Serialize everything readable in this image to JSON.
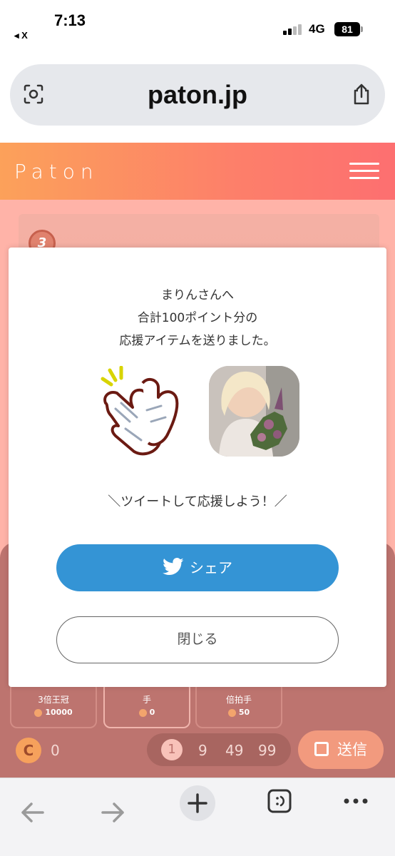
{
  "status_bar": {
    "time": "7:13",
    "back_app": "◂ X",
    "network": "4G",
    "battery": "81"
  },
  "browser": {
    "url": "paton.jp"
  },
  "app": {
    "logo": "Paton",
    "brand_gradient": [
      "#fca15a",
      "#fd6f70"
    ]
  },
  "background": {
    "rank": "3",
    "items": [
      {
        "name": "3倍王冠",
        "price": "10000"
      },
      {
        "name": "手",
        "price": "0"
      },
      {
        "name": "倍拍手",
        "price": "50"
      }
    ],
    "coins": "0",
    "quantities": [
      "1",
      "9",
      "49",
      "99"
    ],
    "selected_quantity": "1",
    "send_label": "送信"
  },
  "modal": {
    "line1": "まりんさんへ",
    "line2": "合計100ポイント分の",
    "line3": "応援アイテムを送りました。",
    "hint": "＼ツイートして応援しよう！／",
    "share_label": "シェア",
    "close_label": "閉じる",
    "share_color": "#3494d5"
  }
}
